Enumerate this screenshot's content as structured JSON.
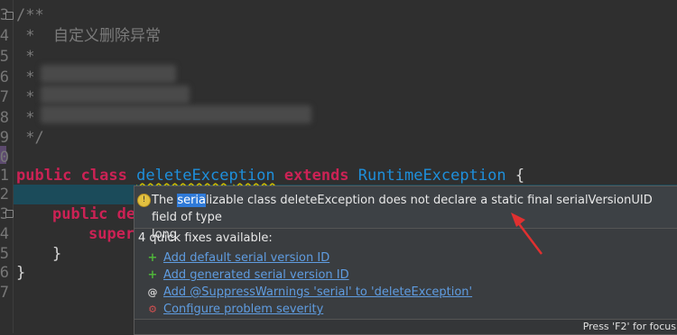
{
  "editor": {
    "line_numbers": [
      "3",
      "4",
      "5",
      "6",
      "7",
      "8",
      "9",
      "0",
      "1",
      "2",
      "3",
      "4",
      "5",
      "6",
      "7"
    ],
    "comment_open": "/**",
    "comment_line1": " *  自定义删除异常",
    "comment_star": " *",
    "comment_close": " */",
    "class_kw_public": "public",
    "class_kw_class": "class",
    "class_name": "deleteException",
    "class_kw_extends": "extends",
    "class_super": "RuntimeException",
    "class_brace": "{",
    "ctor_prefix": "public de",
    "super_prefix": "super",
    "close_inner": "}",
    "close_outer": "}"
  },
  "popup": {
    "msg_pre": "The ",
    "msg_highlight": "seria",
    "msg_post": "lizable class deleteException does not declare a static final serialVersionUID field of type",
    "msg_line2": "long",
    "quick_fixes_header": "4 quick fixes available:",
    "fixes": [
      {
        "icon": "+",
        "label": "Add default serial version ID"
      },
      {
        "icon": "+",
        "label": "Add generated serial version ID"
      },
      {
        "icon": "@",
        "label": "Add @SuppressWarnings 'serial' to 'deleteException'"
      },
      {
        "icon": "⚙",
        "label": "Configure problem severity"
      }
    ],
    "status": "Press 'F2' for focus"
  },
  "colors": {
    "keyword": "#cc2255",
    "type": "#1e8fdb",
    "link": "#5f9ce0",
    "arrow": "#e03030"
  }
}
